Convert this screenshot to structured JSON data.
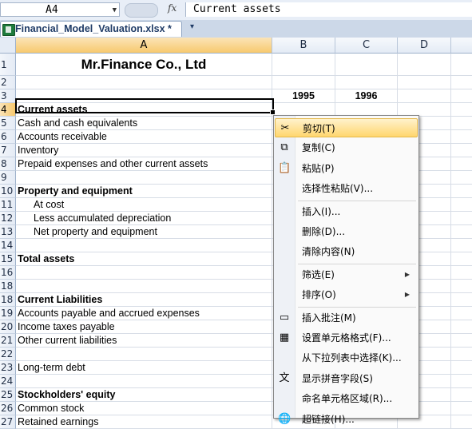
{
  "formula_bar": {
    "name_box": "A4",
    "fx": "fx",
    "content": "Current assets"
  },
  "workbook_tab": {
    "label": "Financial_Model_Valuation.xlsx *",
    "close": "▾"
  },
  "columns": [
    "A",
    "B",
    "C",
    "D"
  ],
  "rows": [
    {
      "n": "1",
      "a": "Mr.Finance Co., Ltd",
      "b": "",
      "c": "",
      "style": "title"
    },
    {
      "n": "2",
      "a": "",
      "b": "",
      "c": ""
    },
    {
      "n": "3",
      "a": "",
      "b": "1995",
      "c": "1996",
      "style": "years"
    },
    {
      "n": "4",
      "a": "Current assets",
      "b": "",
      "c": "",
      "style": "bold",
      "selected": true
    },
    {
      "n": "5",
      "a": "Cash and cash equivalents",
      "b": "",
      "c": ""
    },
    {
      "n": "6",
      "a": "Accounts receivable",
      "b": "",
      "c": ""
    },
    {
      "n": "7",
      "a": "Inventory",
      "b": "",
      "c": ""
    },
    {
      "n": "8",
      "a": "Prepaid expenses and other current assets",
      "b": "",
      "c": ""
    },
    {
      "n": "9",
      "a": "",
      "b": "",
      "c": ""
    },
    {
      "n": "10",
      "a": "Property and equipment",
      "b": "",
      "c": "",
      "style": "bold"
    },
    {
      "n": "11",
      "a": "At cost",
      "b": "",
      "c": "",
      "style": "indent"
    },
    {
      "n": "12",
      "a": "Less accumulated depreciation",
      "b": "",
      "c": "",
      "style": "indent"
    },
    {
      "n": "13",
      "a": "Net property and equipment",
      "b": "",
      "c": "",
      "style": "indent"
    },
    {
      "n": "14",
      "a": "",
      "b": "",
      "c": ""
    },
    {
      "n": "15",
      "a": "Total assets",
      "b": "",
      "c": "",
      "style": "bold"
    },
    {
      "n": "16",
      "a": "",
      "b": "",
      "c": ""
    },
    {
      "n": "18",
      "a": "",
      "b": "",
      "c": ""
    },
    {
      "n": "18",
      "a": "Current Liabilities",
      "b": "",
      "c": "",
      "style": "bold"
    },
    {
      "n": "19",
      "a": "Accounts payable and accrued expenses",
      "b": "",
      "c": ""
    },
    {
      "n": "20",
      "a": "Income taxes payable",
      "b": "",
      "c": ""
    },
    {
      "n": "21",
      "a": "Other current liabilities",
      "b": "",
      "c": ""
    },
    {
      "n": "22",
      "a": "",
      "b": "",
      "c": ""
    },
    {
      "n": "23",
      "a": "Long-term debt",
      "b": "",
      "c": ""
    },
    {
      "n": "24",
      "a": "",
      "b": "",
      "c": ""
    },
    {
      "n": "25",
      "a": "Stockholders' equity",
      "b": "",
      "c": "",
      "style": "bold"
    },
    {
      "n": "26",
      "a": "Common stock",
      "b": "",
      "c": ""
    },
    {
      "n": "27",
      "a": "Retained earnings",
      "b": "",
      "c": ""
    }
  ],
  "context_menu": [
    {
      "label": "剪切(T)",
      "icon": "scissors-icon",
      "glyph": "✂",
      "highlighted": true
    },
    {
      "label": "复制(C)",
      "icon": "copy-icon",
      "glyph": "⧉"
    },
    {
      "label": "粘贴(P)",
      "icon": "paste-icon",
      "glyph": "📋"
    },
    {
      "label": "选择性粘贴(V)...",
      "icon": "",
      "glyph": ""
    },
    {
      "sep": true
    },
    {
      "label": "插入(I)...",
      "icon": "",
      "glyph": ""
    },
    {
      "label": "删除(D)...",
      "icon": "",
      "glyph": ""
    },
    {
      "label": "清除内容(N)",
      "icon": "",
      "glyph": ""
    },
    {
      "sep": true
    },
    {
      "label": "筛选(E)",
      "icon": "",
      "glyph": "",
      "submenu": true
    },
    {
      "label": "排序(O)",
      "icon": "",
      "glyph": "",
      "submenu": true
    },
    {
      "sep": true
    },
    {
      "label": "插入批注(M)",
      "icon": "comment-icon",
      "glyph": "▭"
    },
    {
      "label": "设置单元格格式(F)...",
      "icon": "format-cells-icon",
      "glyph": "▦"
    },
    {
      "label": "从下拉列表中选择(K)...",
      "icon": "",
      "glyph": ""
    },
    {
      "label": "显示拼音字段(S)",
      "icon": "phonetic-icon",
      "glyph": "文"
    },
    {
      "label": "命名单元格区域(R)...",
      "icon": "",
      "glyph": ""
    },
    {
      "label": "超链接(H)...",
      "icon": "hyperlink-icon",
      "glyph": "🌐"
    }
  ]
}
